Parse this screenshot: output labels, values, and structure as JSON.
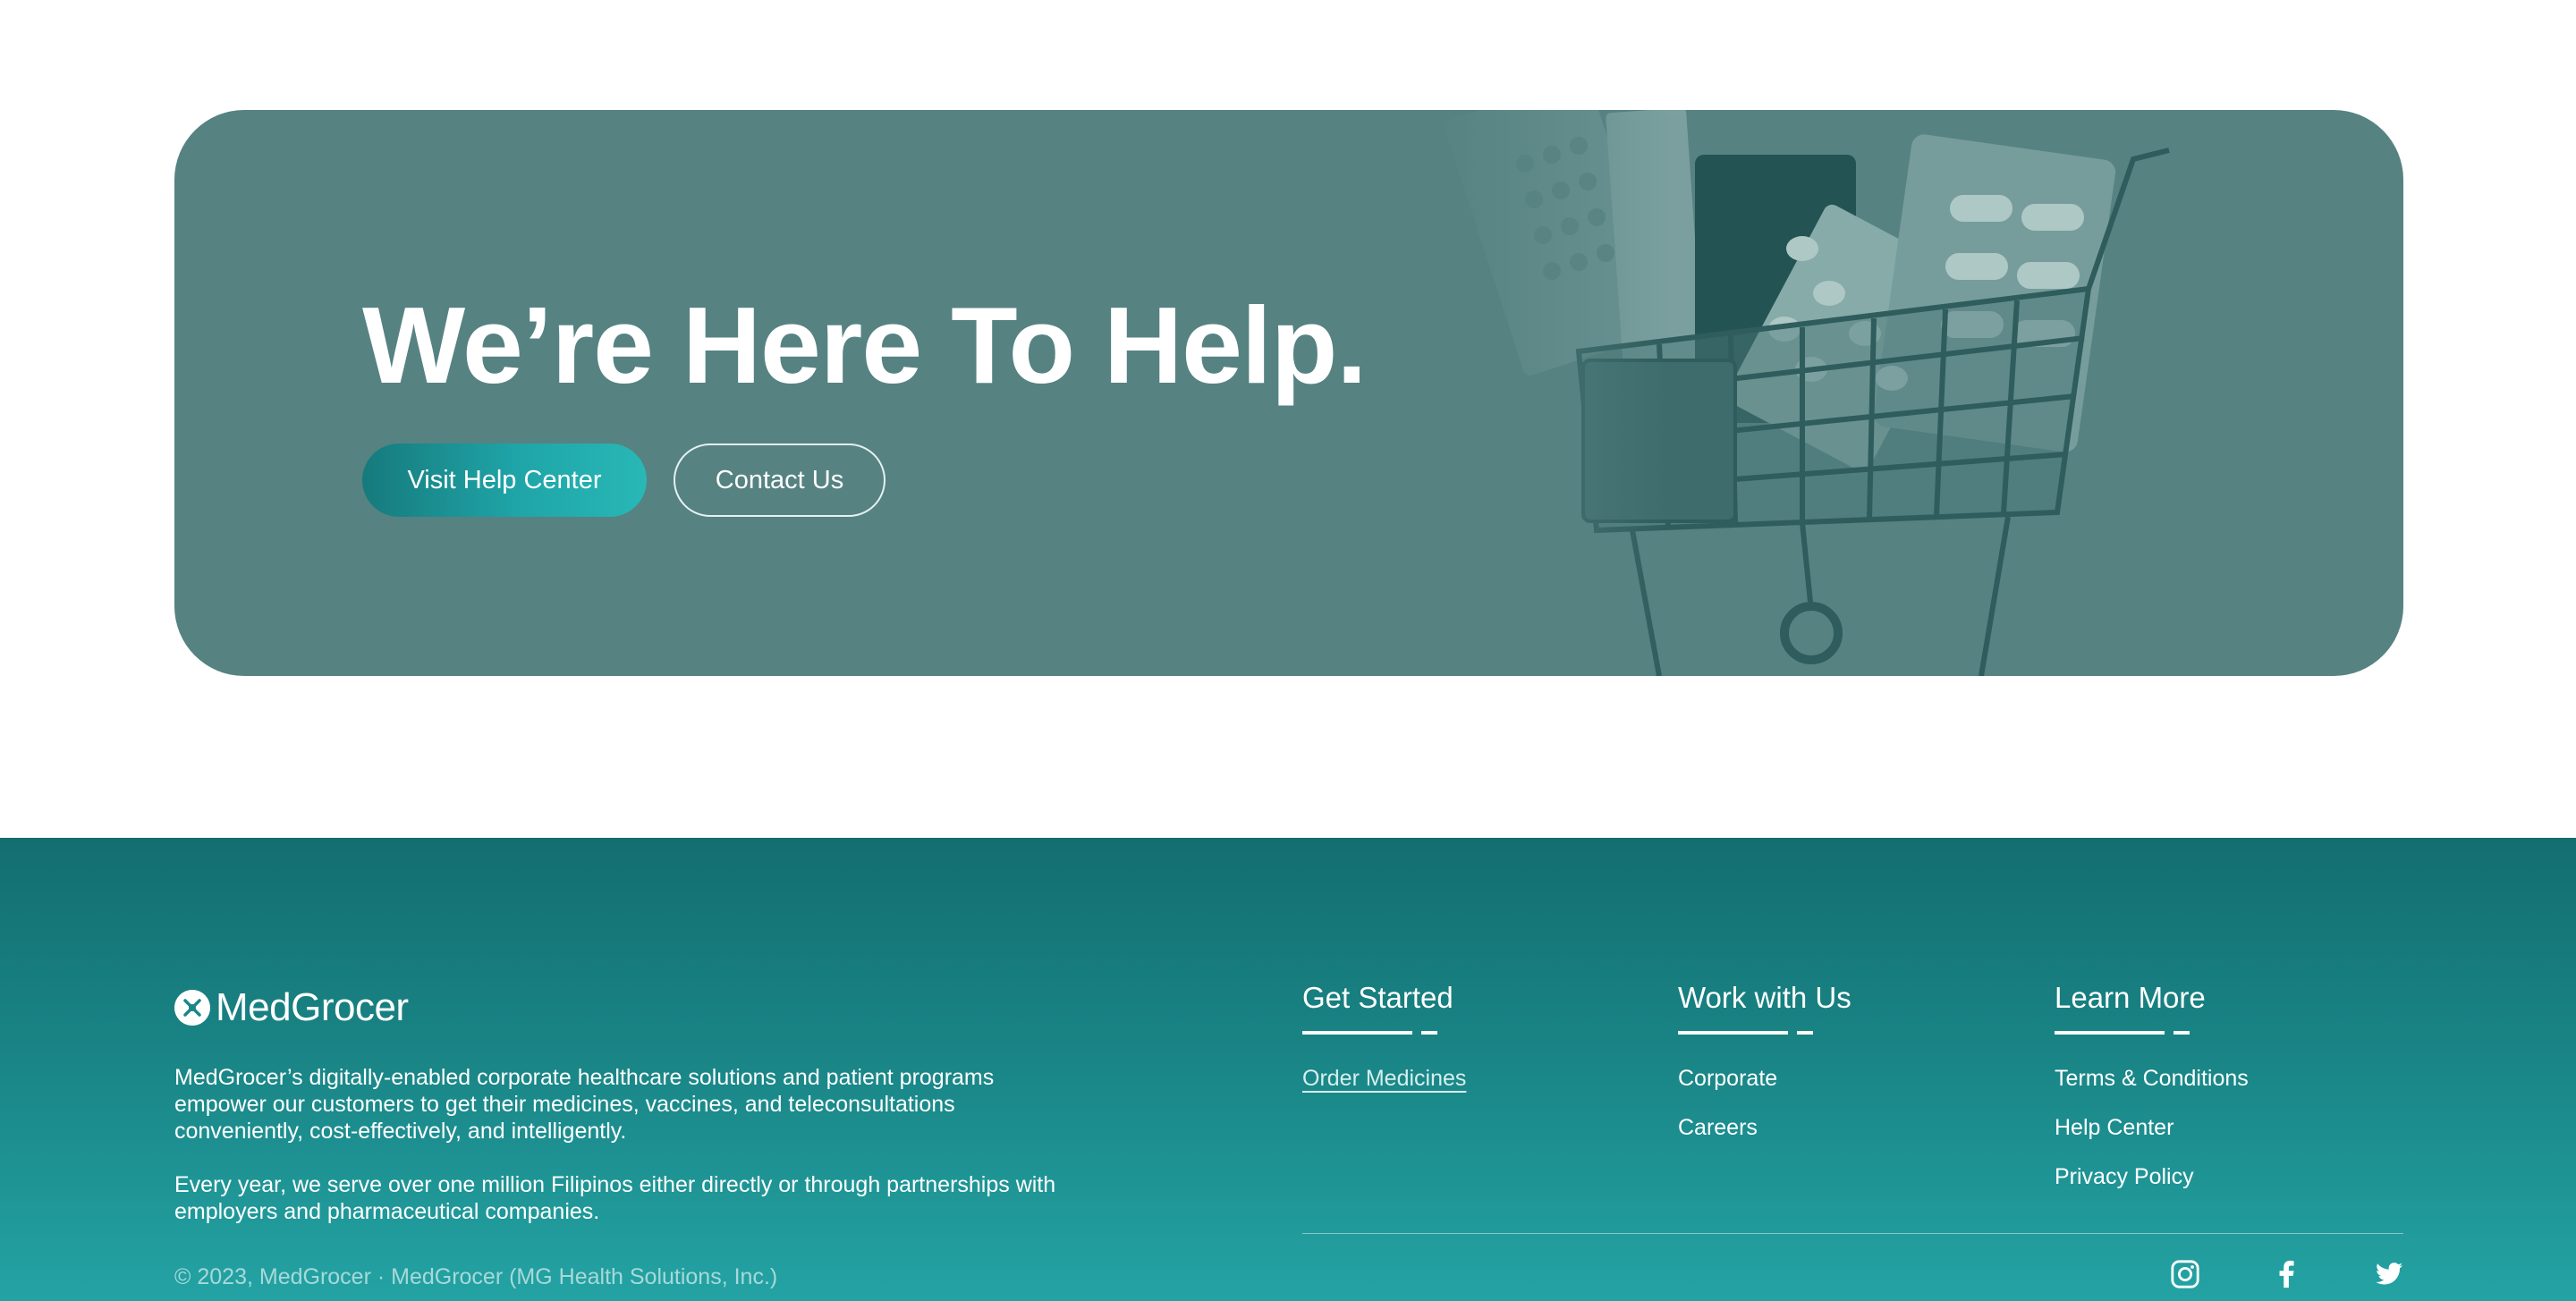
{
  "hero": {
    "title": "We’re Here To Help.",
    "primary_button": "Visit Help Center",
    "secondary_button": "Contact Us"
  },
  "footer": {
    "brand": "MedGrocer",
    "about": [
      "MedGrocer’s digitally-enabled corporate healthcare solutions and patient programs empower our customers to get their medicines, vaccines, and teleconsultations conveniently, cost-effectively, and intelligently.",
      "Every year, we serve over one million Filipinos either directly or through partnerships with employers and pharmaceutical companies."
    ],
    "columns": [
      {
        "title": "Get Started",
        "links": [
          "Order Medicines"
        ]
      },
      {
        "title": "Work with Us",
        "links": [
          "Corporate",
          "Careers"
        ]
      },
      {
        "title": "Learn More",
        "links": [
          "Terms & Conditions",
          "Help Center",
          "Privacy Policy"
        ]
      }
    ],
    "copyright": "© 2023, MedGrocer · MedGrocer (MG Health Solutions, Inc.)",
    "social": [
      "instagram-icon",
      "facebook-icon",
      "twitter-icon"
    ]
  },
  "colors": {
    "hero_bg": "#568282",
    "footer_top": "#136e70",
    "footer_bottom": "#24a3a4",
    "button_gradient_start": "#167a7c",
    "button_gradient_end": "#28b8b6"
  }
}
